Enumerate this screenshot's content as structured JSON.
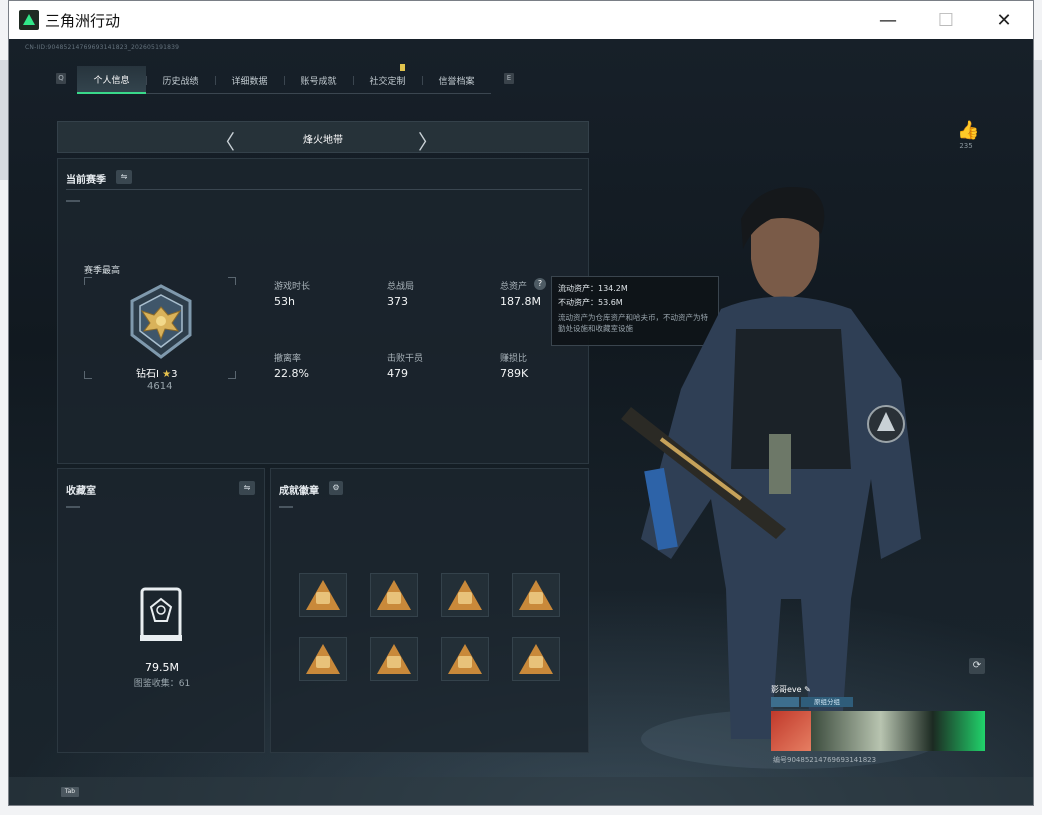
{
  "window": {
    "title": "三角洲行动",
    "minimize_glyph": "—",
    "maximize_glyph": "☐",
    "close_glyph": "✕"
  },
  "profile_id_top": "CN-IID:9048521476969314182​3_202605191839",
  "tabs": [
    {
      "label": "个人信息",
      "active": true
    },
    {
      "label": "历史战绩",
      "active": false
    },
    {
      "label": "详细数据",
      "active": false
    },
    {
      "label": "账号成就",
      "active": false
    },
    {
      "label": "社交定制",
      "active": false,
      "badge": true
    },
    {
      "label": "信誉档案",
      "active": false
    }
  ],
  "season_selector": {
    "name": "烽火地带",
    "prev_glyph": "〈",
    "next_glyph": "〉"
  },
  "current_season": {
    "title": "当前赛季",
    "rank_label": "赛季最高",
    "rank_name": "钻石Ⅰ",
    "rank_stars": "3",
    "rank_score": "4614",
    "stats": [
      {
        "label": "游戏时长",
        "value": "53h"
      },
      {
        "label": "总战局",
        "value": "373"
      },
      {
        "label": "总资产",
        "value": "187.8M"
      },
      {
        "label": "撤离率",
        "value": "22.8%"
      },
      {
        "label": "击败干员",
        "value": "479"
      },
      {
        "label": "赚损比",
        "value": "789K"
      }
    ]
  },
  "tooltip": {
    "liquid": "流动资产：134.2M",
    "fixed": "不动资产：53.6M",
    "note": "流动资产为仓库资产和哈夫币，不动资产为特勤处设施和收藏室设施"
  },
  "collection": {
    "title": "收藏室",
    "value": "79.5M",
    "count_label": "图鉴收集：61"
  },
  "badges": {
    "title": "成就徽章",
    "count": 8
  },
  "likes": {
    "count": "235"
  },
  "player_card": {
    "name": "影哥eve",
    "tag": "原组分组",
    "id": "编号9048521476969314182​3"
  },
  "icons": {
    "swap": "⇋",
    "gear": "⚙",
    "help": "?",
    "like": "👍",
    "refresh": "⟳",
    "edit": "✎"
  },
  "colors": {
    "accent": "#39d98a",
    "badge_gold": "#c9893a"
  },
  "bottom": {
    "tab_key": "Tab"
  }
}
